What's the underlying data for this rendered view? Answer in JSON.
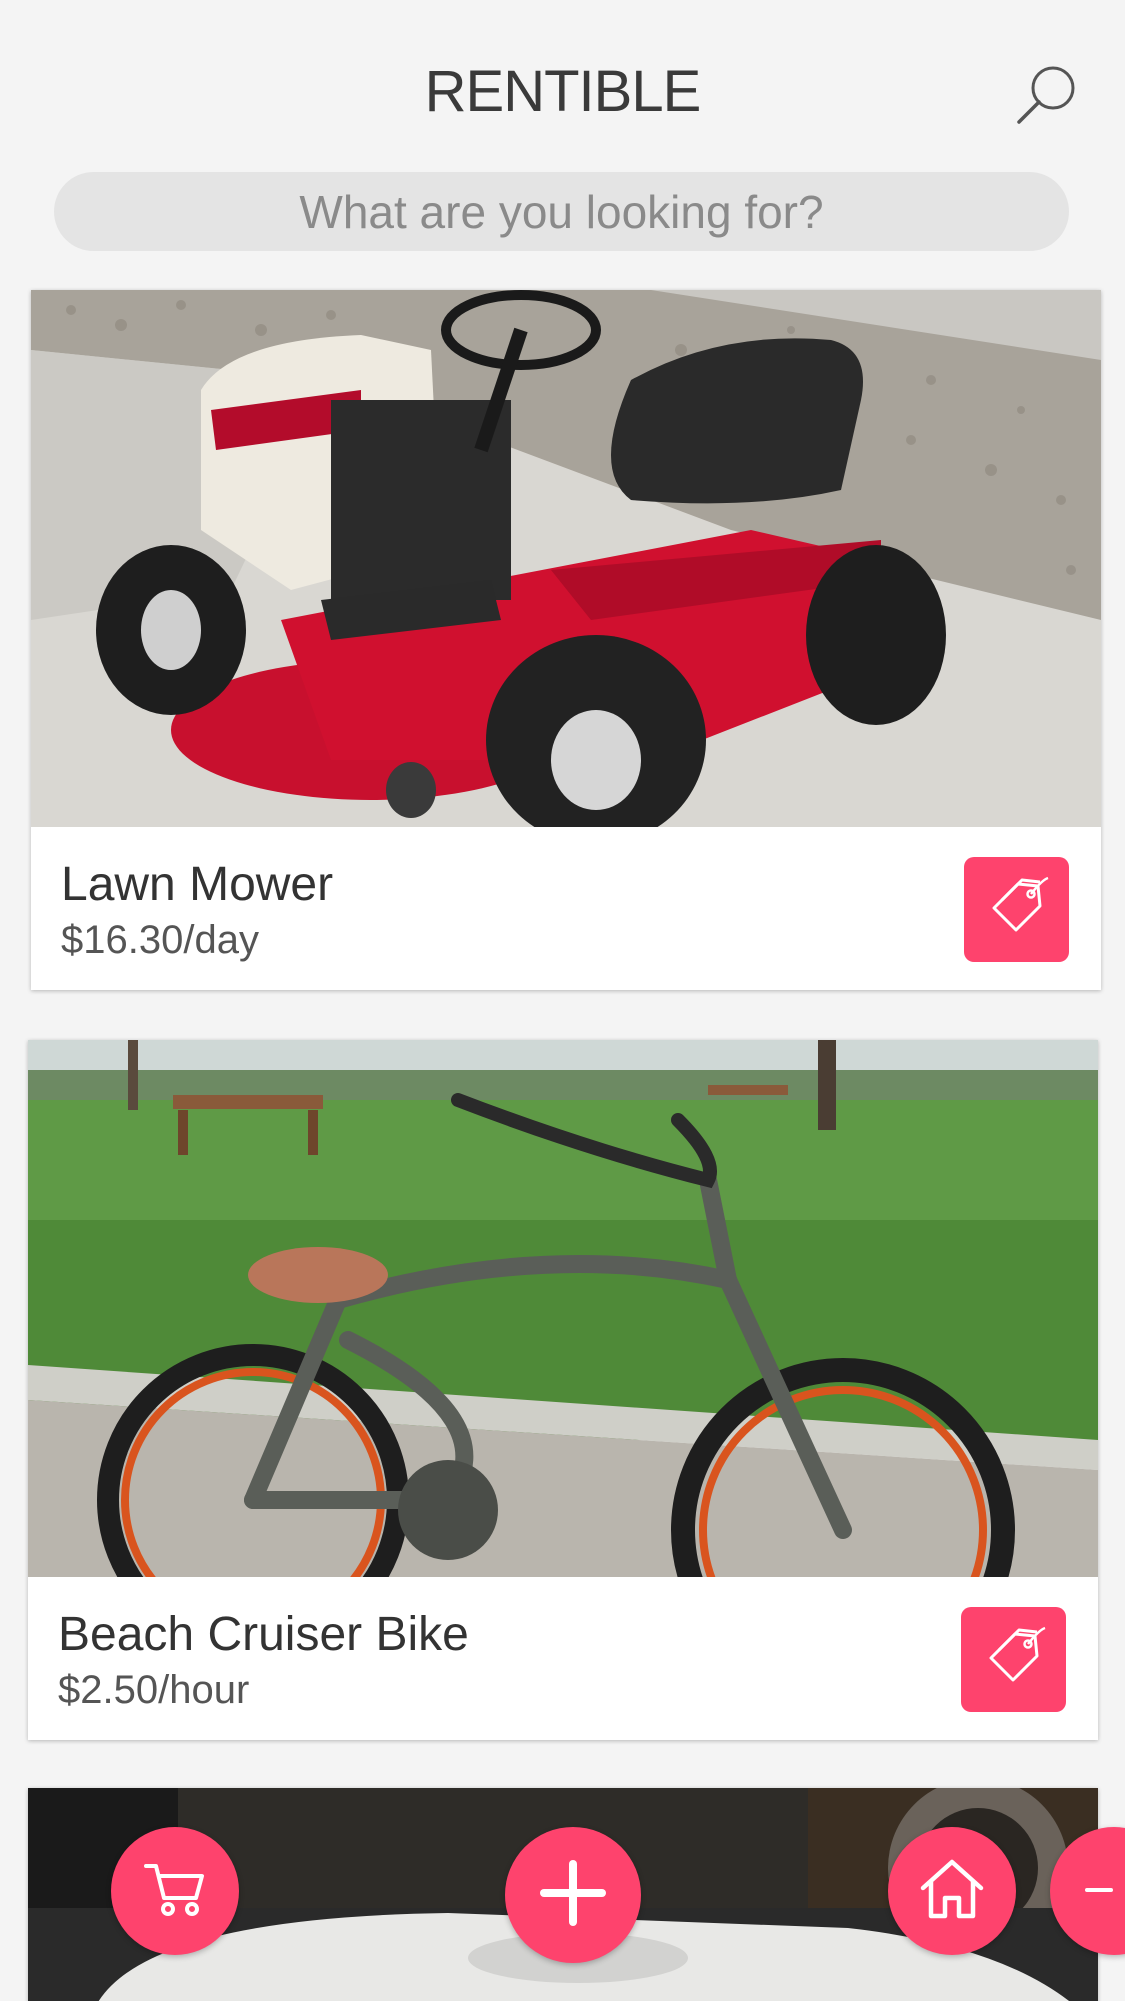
{
  "header": {
    "app_title": "RENTIBLE",
    "search_icon": "search-icon"
  },
  "search": {
    "placeholder": "What are you looking for?"
  },
  "listings": [
    {
      "name": "Lawn Mower",
      "price": "$16.30/day",
      "image": "red riding lawn mower on driveway",
      "action_icon": "tag-icon"
    },
    {
      "name": "Beach Cruiser Bike",
      "price": "$2.50/hour",
      "image": "grey beach cruiser bike with orange rims in park",
      "action_icon": "tag-icon"
    },
    {
      "name": "",
      "price": "",
      "image": "white appliance partially visible"
    }
  ],
  "fab": {
    "cart_icon": "cart-icon",
    "add_icon": "plus-icon",
    "home_icon": "home-icon",
    "extra_icon": "minus-icon"
  },
  "colors": {
    "accent": "#fe436d",
    "background": "#f4f4f4",
    "search_bar": "#e4e4e4"
  }
}
